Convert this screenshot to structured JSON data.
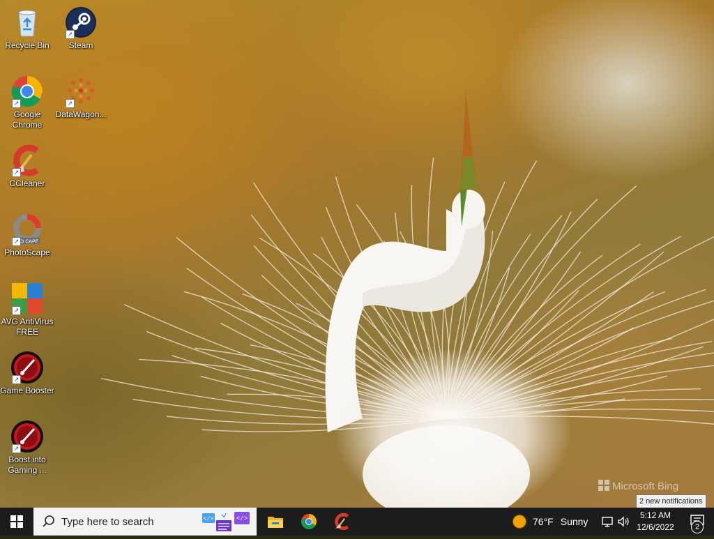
{
  "desktop": {
    "icons": [
      {
        "label": "Recycle Bin",
        "icon": "recycle-bin-icon"
      },
      {
        "label": "Steam",
        "icon": "steam-icon"
      },
      {
        "label": "Google Chrome",
        "icon": "chrome-icon"
      },
      {
        "label": "DataWagon...",
        "icon": "datawagon-icon"
      },
      {
        "label": "CCleaner",
        "icon": "ccleaner-icon"
      },
      {
        "label": "PhotoScape",
        "icon": "photoscape-icon"
      },
      {
        "label": "AVG AntiVirus FREE",
        "icon": "avg-icon"
      },
      {
        "label": "Game Booster",
        "icon": "game-booster-icon"
      },
      {
        "label": "Boost into Gaming ...",
        "icon": "boost-gaming-icon"
      }
    ],
    "photoscape_logo_text": "TO CAPE",
    "watermark": "Microsoft Bing"
  },
  "taskbar": {
    "search_placeholder": "Type here to search",
    "pinned": [
      {
        "name": "File Explorer",
        "icon": "file-explorer-icon"
      },
      {
        "name": "Google Chrome",
        "icon": "chrome-icon"
      },
      {
        "name": "CCleaner",
        "icon": "ccleaner-icon"
      }
    ],
    "weather": {
      "temp": "76°F",
      "condition": "Sunny"
    },
    "time": "5:12 AM",
    "date": "12/6/2022",
    "notification_count": "2",
    "tooltip": "2 new notifications"
  },
  "colors": {
    "taskbar": "#1c1c1c",
    "search_box": "#f3f3f3",
    "windows_blue": "#1e90ff",
    "sun": "#f5a300"
  }
}
